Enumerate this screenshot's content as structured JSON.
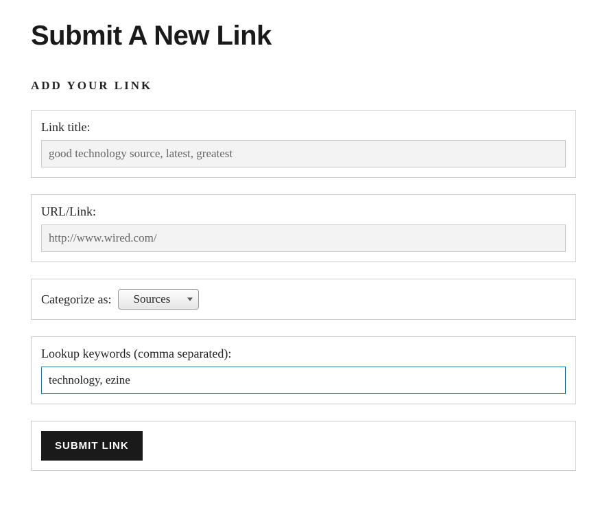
{
  "page": {
    "title": "Submit A New Link"
  },
  "section": {
    "heading": "ADD YOUR LINK"
  },
  "linkTitle": {
    "label": "Link title:",
    "value": "good technology source, latest, greatest"
  },
  "urlLink": {
    "label": "URL/Link:",
    "value": "http://www.wired.com/"
  },
  "categorize": {
    "label": "Categorize as:",
    "selected": "Sources"
  },
  "keywords": {
    "label": "Lookup keywords (comma separated):",
    "value": "technology, ezine"
  },
  "submit": {
    "label": "SUBMIT LINK"
  }
}
